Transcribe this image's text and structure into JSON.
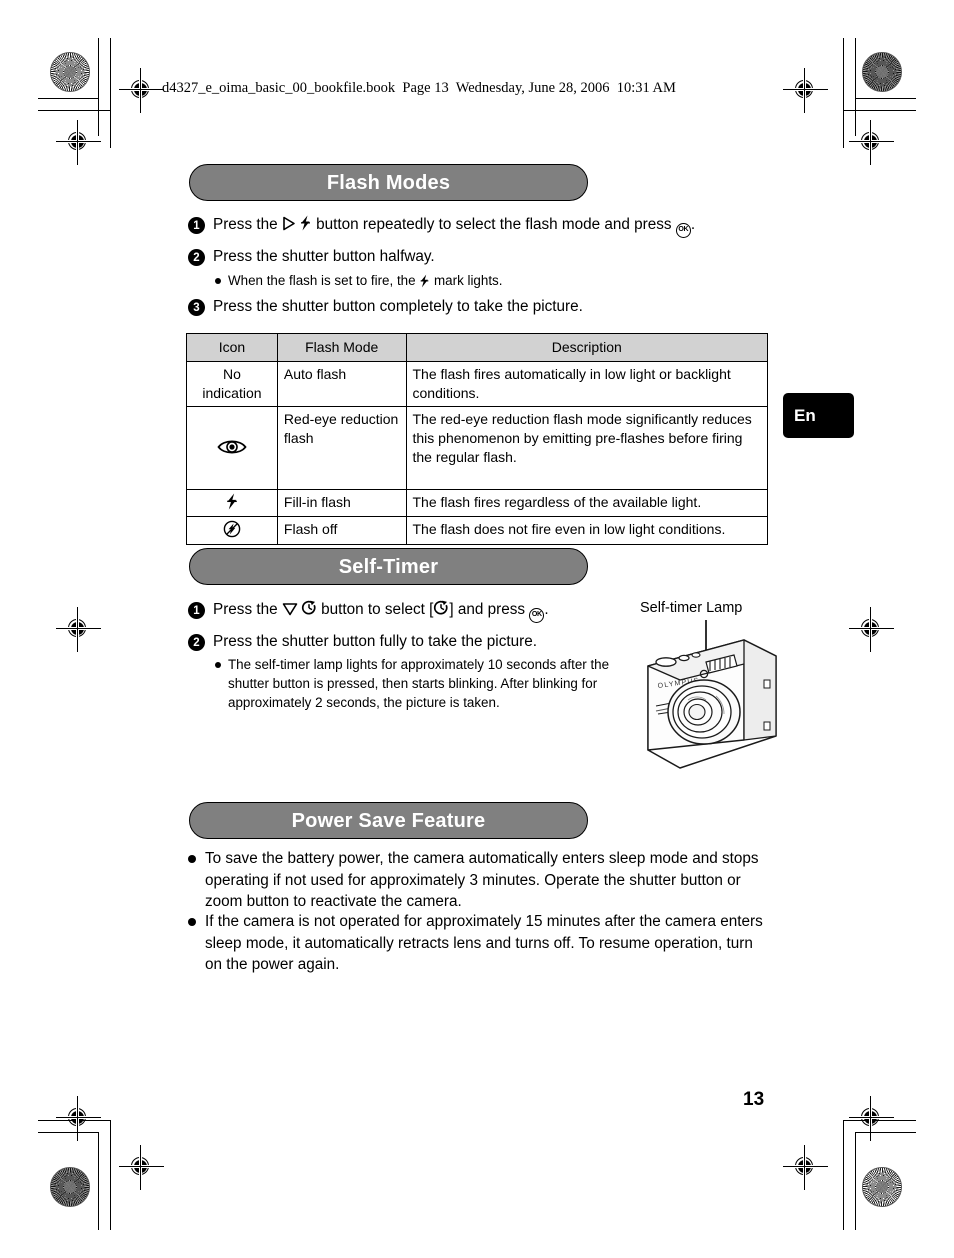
{
  "document": {
    "header_line": "d4327_e_oima_basic_00_bookfile.book  Page 13  Wednesday, June 28, 2006  10:31 AM",
    "page_number": "13",
    "language_tab": "En",
    "colors": {
      "section_bar_fill": "#808080",
      "section_bar_text": "#ffffff",
      "table_header_fill": "#d2d2d2",
      "tab_fill": "#000000",
      "rule": "#000000"
    }
  },
  "sections": {
    "flash": {
      "title": "Flash Modes",
      "steps": [
        {
          "num": "1",
          "pre": "Press the ",
          "icon1": "arrow-right-icon",
          "icon2": "flash-icon",
          "mid": " button repeatedly to select the flash mode and press ",
          "icon3": "ok-button-icon",
          "post": "."
        },
        {
          "num": "2",
          "text": "Press the shutter button halfway."
        },
        {
          "num": "3",
          "text": "Press the shutter button completely to take the picture."
        }
      ],
      "note": {
        "pre": "When the flash is set to fire, the ",
        "icon": "flash-icon",
        "post": " mark lights."
      },
      "table": {
        "headers": [
          "Icon",
          "Flash Mode",
          "Description"
        ],
        "rows": [
          {
            "icon_kind": "text",
            "icon": "No indication",
            "mode": "Auto flash",
            "description": "The flash fires automatically in low light or backlight conditions."
          },
          {
            "icon_kind": "red-eye-icon",
            "icon": "",
            "mode": "Red-eye reduction flash",
            "description": "The red-eye reduction flash mode significantly reduces this phenomenon by emitting pre-flashes before firing the regular flash."
          },
          {
            "icon_kind": "flash-icon",
            "icon": "",
            "mode": "Fill-in flash",
            "description": "The flash fires regardless of the available light."
          },
          {
            "icon_kind": "flash-off-icon",
            "icon": "",
            "mode": "Flash off",
            "description": "The flash does not fire even in low light conditions."
          }
        ]
      }
    },
    "selftimer": {
      "title": "Self-Timer",
      "steps": [
        {
          "num": "1",
          "pre": "Press the ",
          "icon1": "arrow-down-icon",
          "icon2": "self-timer-icon",
          "mid": " button to select [",
          "icon3": "self-timer-icon",
          "mid2": "] and press ",
          "icon4": "ok-button-icon",
          "post": "."
        },
        {
          "num": "2",
          "text": "Press the shutter button fully to take the picture."
        }
      ],
      "note": "The self-timer lamp lights for approximately 10 seconds after the shutter button is pressed, then starts blinking. After blinking for approximately 2 seconds, the picture is taken.",
      "figure": {
        "caption": "Self-timer Lamp",
        "alt": "olympus-compact-camera-illustration",
        "brand": "OLYMPUS"
      }
    },
    "powersave": {
      "title": "Power Save Feature",
      "bullets": [
        "To save the battery power, the camera automatically enters sleep mode and stops operating if not used for approximately 3 minutes. Operate the shutter button or zoom button to reactivate the camera.",
        "If the camera is not operated for approximately 15 minutes after the camera enters sleep mode, it automatically retracts lens and turns off. To resume operation, turn on the power again."
      ]
    }
  }
}
